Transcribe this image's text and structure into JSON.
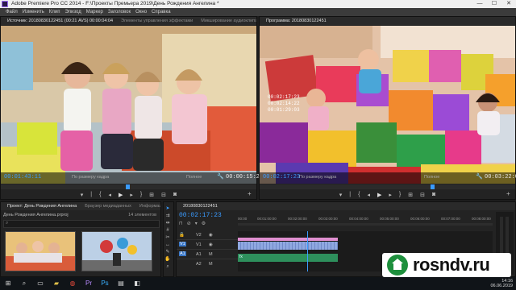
{
  "window": {
    "title": "Adobe Premiere Pro CC 2014 - F:\\Проекты Премьера 2019\\День Рождения Ангелина *",
    "controls": [
      "—",
      "☐",
      "✕"
    ]
  },
  "menu": [
    "Файл",
    "Изменить",
    "Клип",
    "Эпизод",
    "Маркер",
    "Заголовок",
    "Окно",
    "Справка"
  ],
  "source_panel": {
    "tabs": [
      "Источник: 20180830122451 (00:21 AVS) 00:00:04:04",
      "Элементы управления эффектами",
      "Микширование аудиоклипа: 20180830"
    ],
    "timecode_left": "00:01:43:11",
    "fit_label": "По размеру кадра",
    "quality": "Полное",
    "timecode_right": "00:00:15:21"
  },
  "program_panel": {
    "tabs": [
      "Программа: 20180830122451"
    ],
    "timecode_left": "00:02:17:23",
    "fit_label": "По размеру кадра",
    "quality": "Полное",
    "timecode_right": "00:03:22:05",
    "overlay_lines": [
      "00:02:17:23",
      "00:02:14:22",
      "00:01:29:03"
    ]
  },
  "project_panel": {
    "tabs": [
      "Проект: День Рождения Ангелина",
      "Браузер медиаданных",
      "Информация"
    ],
    "project_file": "День Рождения Ангелина.prproj",
    "item_count": "14 элементов"
  },
  "timeline_panel": {
    "tab": "20180830122451",
    "timecode": "00:02:17:23",
    "ruler": [
      "00:00",
      "00:01:00:00",
      "00:02:00:00",
      "00:03:00:00",
      "00:04:00:00",
      "00:05:00:00",
      "00:06:00:00",
      "00:07:00:00",
      "00:08:00:00"
    ],
    "tracks": [
      "V2",
      "V1",
      "A1",
      "A2"
    ],
    "audio_clip_label": "fx"
  },
  "taskbar": {
    "time": "14:16",
    "date": "06.06.2019"
  },
  "watermark": {
    "text": "rosndv.ru",
    "color": "#1d8f3c"
  },
  "colors": {
    "accent_blue": "#3a9bff",
    "clip_blue": "#8fa8e0",
    "clip_pink": "#e08fd0",
    "clip_green": "#2e8f5c"
  }
}
